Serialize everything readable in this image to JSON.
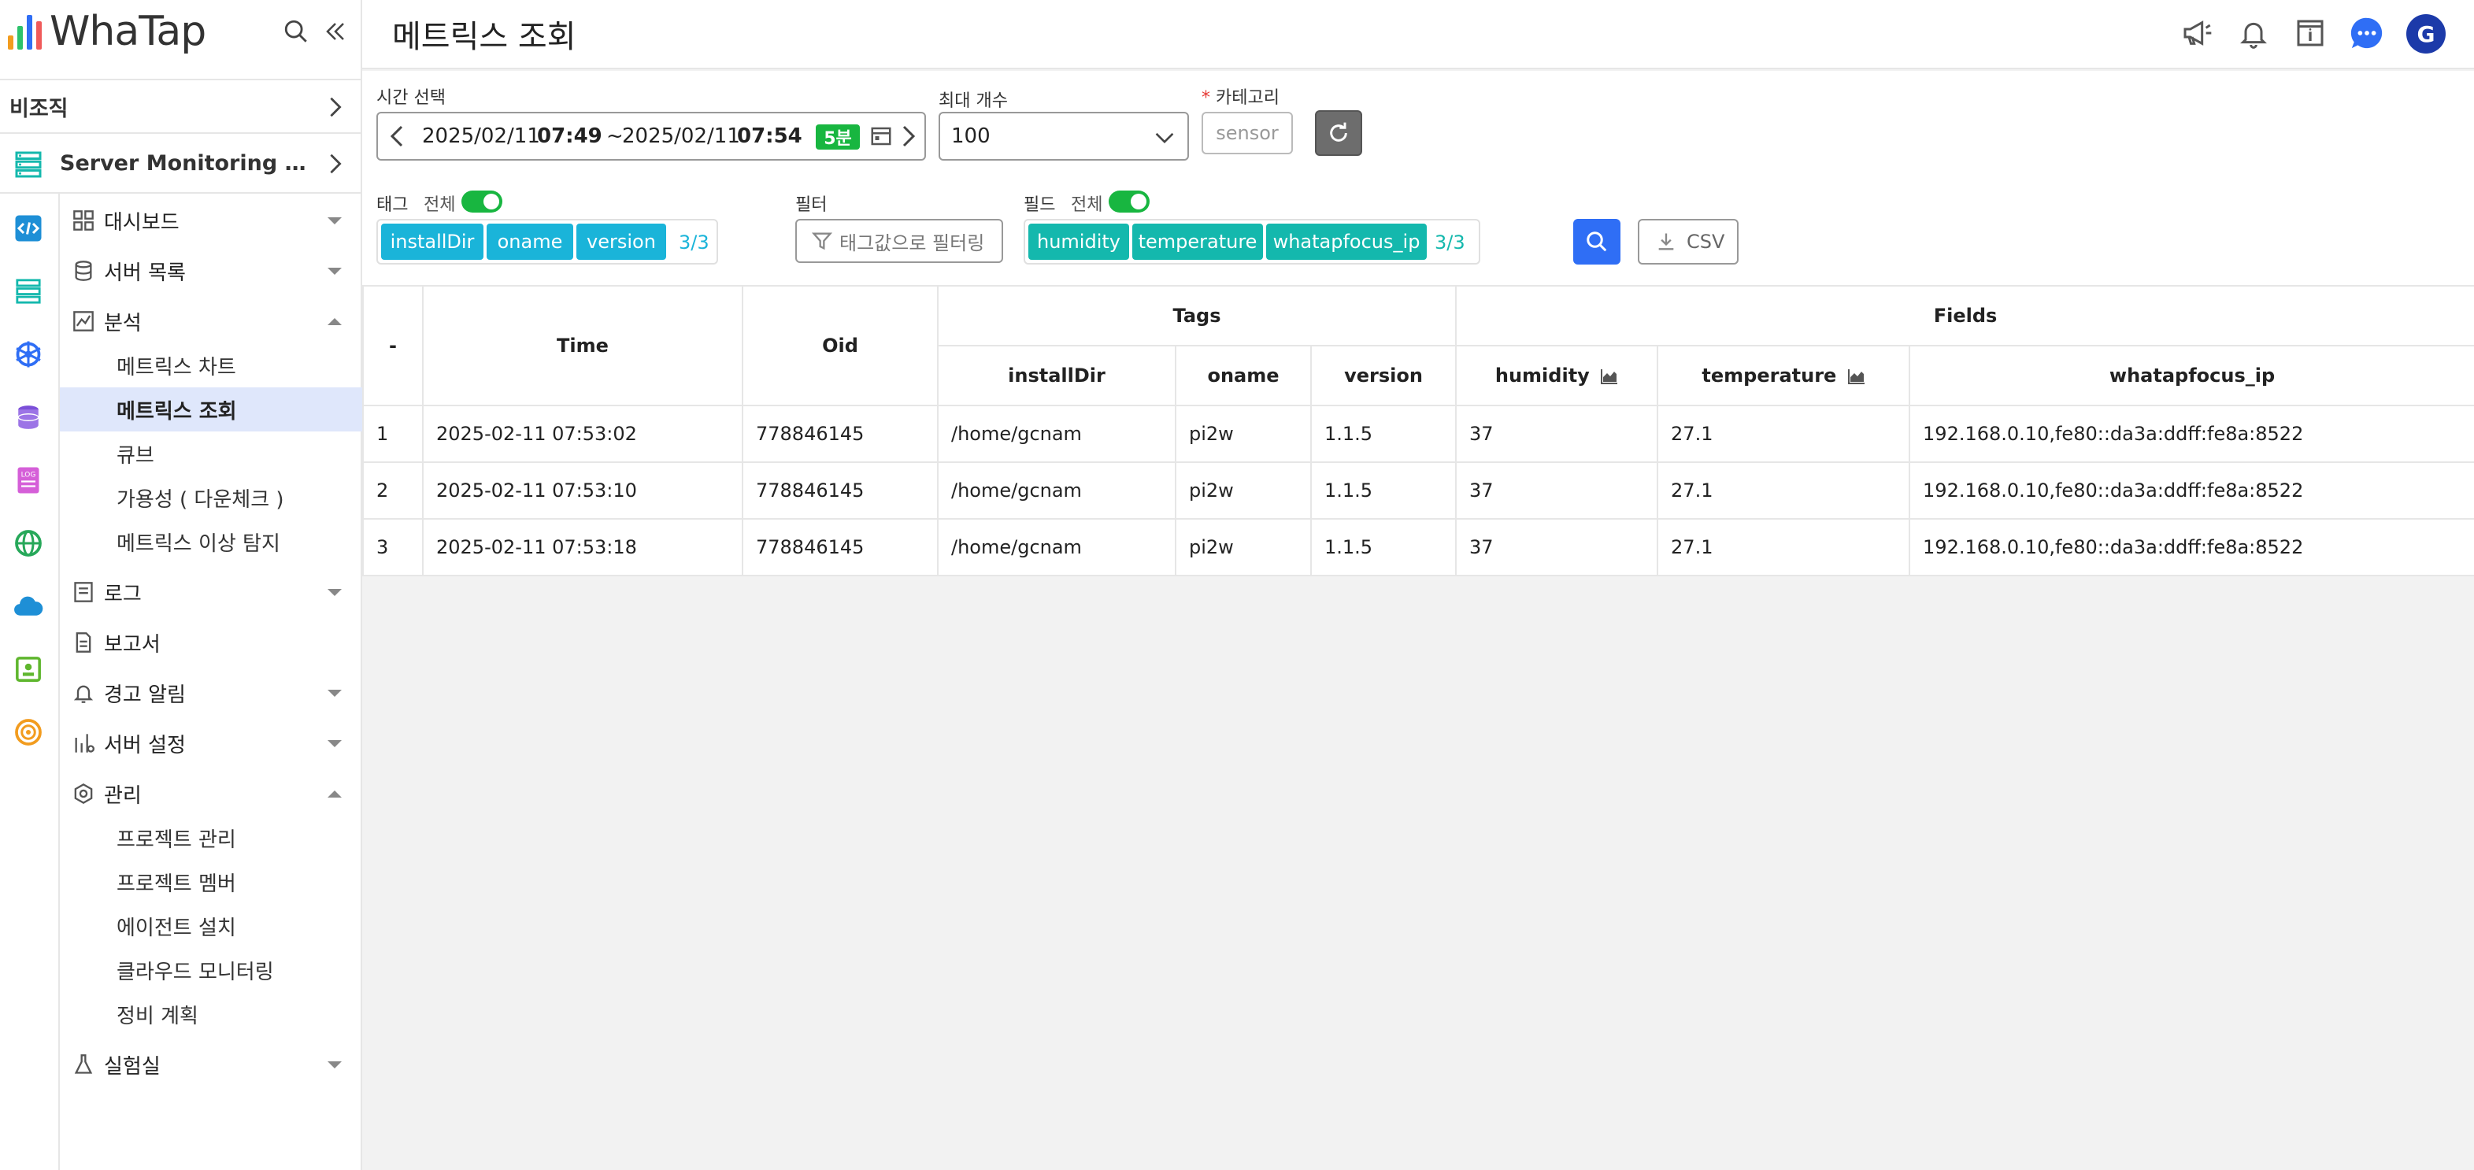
{
  "brand": {
    "name": "WhaTap",
    "bar_colors": [
      "#f29c1f",
      "#2dc26b",
      "#2f6ef5",
      "#f05a5a"
    ]
  },
  "sidebar": {
    "org_label": "비조직",
    "project_name": "Server Monitoring By Gic...",
    "menu": {
      "dashboard": "대시보드",
      "server_list": "서버 목록",
      "analysis": "분석",
      "analysis_sub": [
        "메트릭스 차트",
        "메트릭스 조회",
        "큐브",
        "가용성 ( 다운체크 )",
        "메트릭스 이상 탐지"
      ],
      "log": "로그",
      "report": "보고서",
      "alert": "경고 알림",
      "server_settings": "서버 설정",
      "management": "관리",
      "management_sub": [
        "프로젝트 관리",
        "프로젝트 멤버",
        "에이전트 설치",
        "클라우드 모니터링",
        "정비 계획"
      ],
      "lab": "실험실"
    }
  },
  "header": {
    "title": "메트릭스 조회",
    "avatar_letter": "G",
    "accent": "#2f6ef5"
  },
  "filters": {
    "time_label": "시간 선택",
    "time_start_date": "2025/02/11",
    "time_start_time": "07:49",
    "time_sep": "~",
    "time_end_date": "2025/02/11",
    "time_end_time": "07:54",
    "time_badge": "5분",
    "max_count_label": "최대 개수",
    "max_count_value": "100",
    "category_label": "카테고리",
    "category_required": "*",
    "category_value": "sensor",
    "tags_label": "태그",
    "tags_all": "전체",
    "tags": [
      "installDir",
      "oname",
      "version"
    ],
    "tags_count": "3/3",
    "filter_label": "필터",
    "filter_button": "태그값으로 필터링",
    "fields_label": "필드",
    "fields_all": "전체",
    "fields": [
      "humidity",
      "temperature",
      "whatapfocus_ip"
    ],
    "fields_count": "3/3",
    "csv_label": "CSV"
  },
  "table": {
    "headers": {
      "index": "-",
      "time": "Time",
      "oid": "Oid",
      "tags_group": "Tags",
      "fields_group": "Fields",
      "installDir": "installDir",
      "oname": "oname",
      "version": "version",
      "humidity": "humidity",
      "temperature": "temperature",
      "whatapfocus_ip": "whatapfocus_ip"
    },
    "rows": [
      {
        "idx": "1",
        "time": "2025-02-11 07:53:02",
        "oid": "778846145",
        "installDir": "/home/gcnam",
        "oname": "pi2w",
        "version": "1.1.5",
        "humidity": "37",
        "temperature": "27.1",
        "ip": "192.168.0.10,fe80::da3a:ddff:fe8a:8522"
      },
      {
        "idx": "2",
        "time": "2025-02-11 07:53:10",
        "oid": "778846145",
        "installDir": "/home/gcnam",
        "oname": "pi2w",
        "version": "1.1.5",
        "humidity": "37",
        "temperature": "27.1",
        "ip": "192.168.0.10,fe80::da3a:ddff:fe8a:8522"
      },
      {
        "idx": "3",
        "time": "2025-02-11 07:53:18",
        "oid": "778846145",
        "installDir": "/home/gcnam",
        "oname": "pi2w",
        "version": "1.1.5",
        "humidity": "37",
        "temperature": "27.1",
        "ip": "192.168.0.10,fe80::da3a:ddff:fe8a:8522"
      }
    ]
  }
}
